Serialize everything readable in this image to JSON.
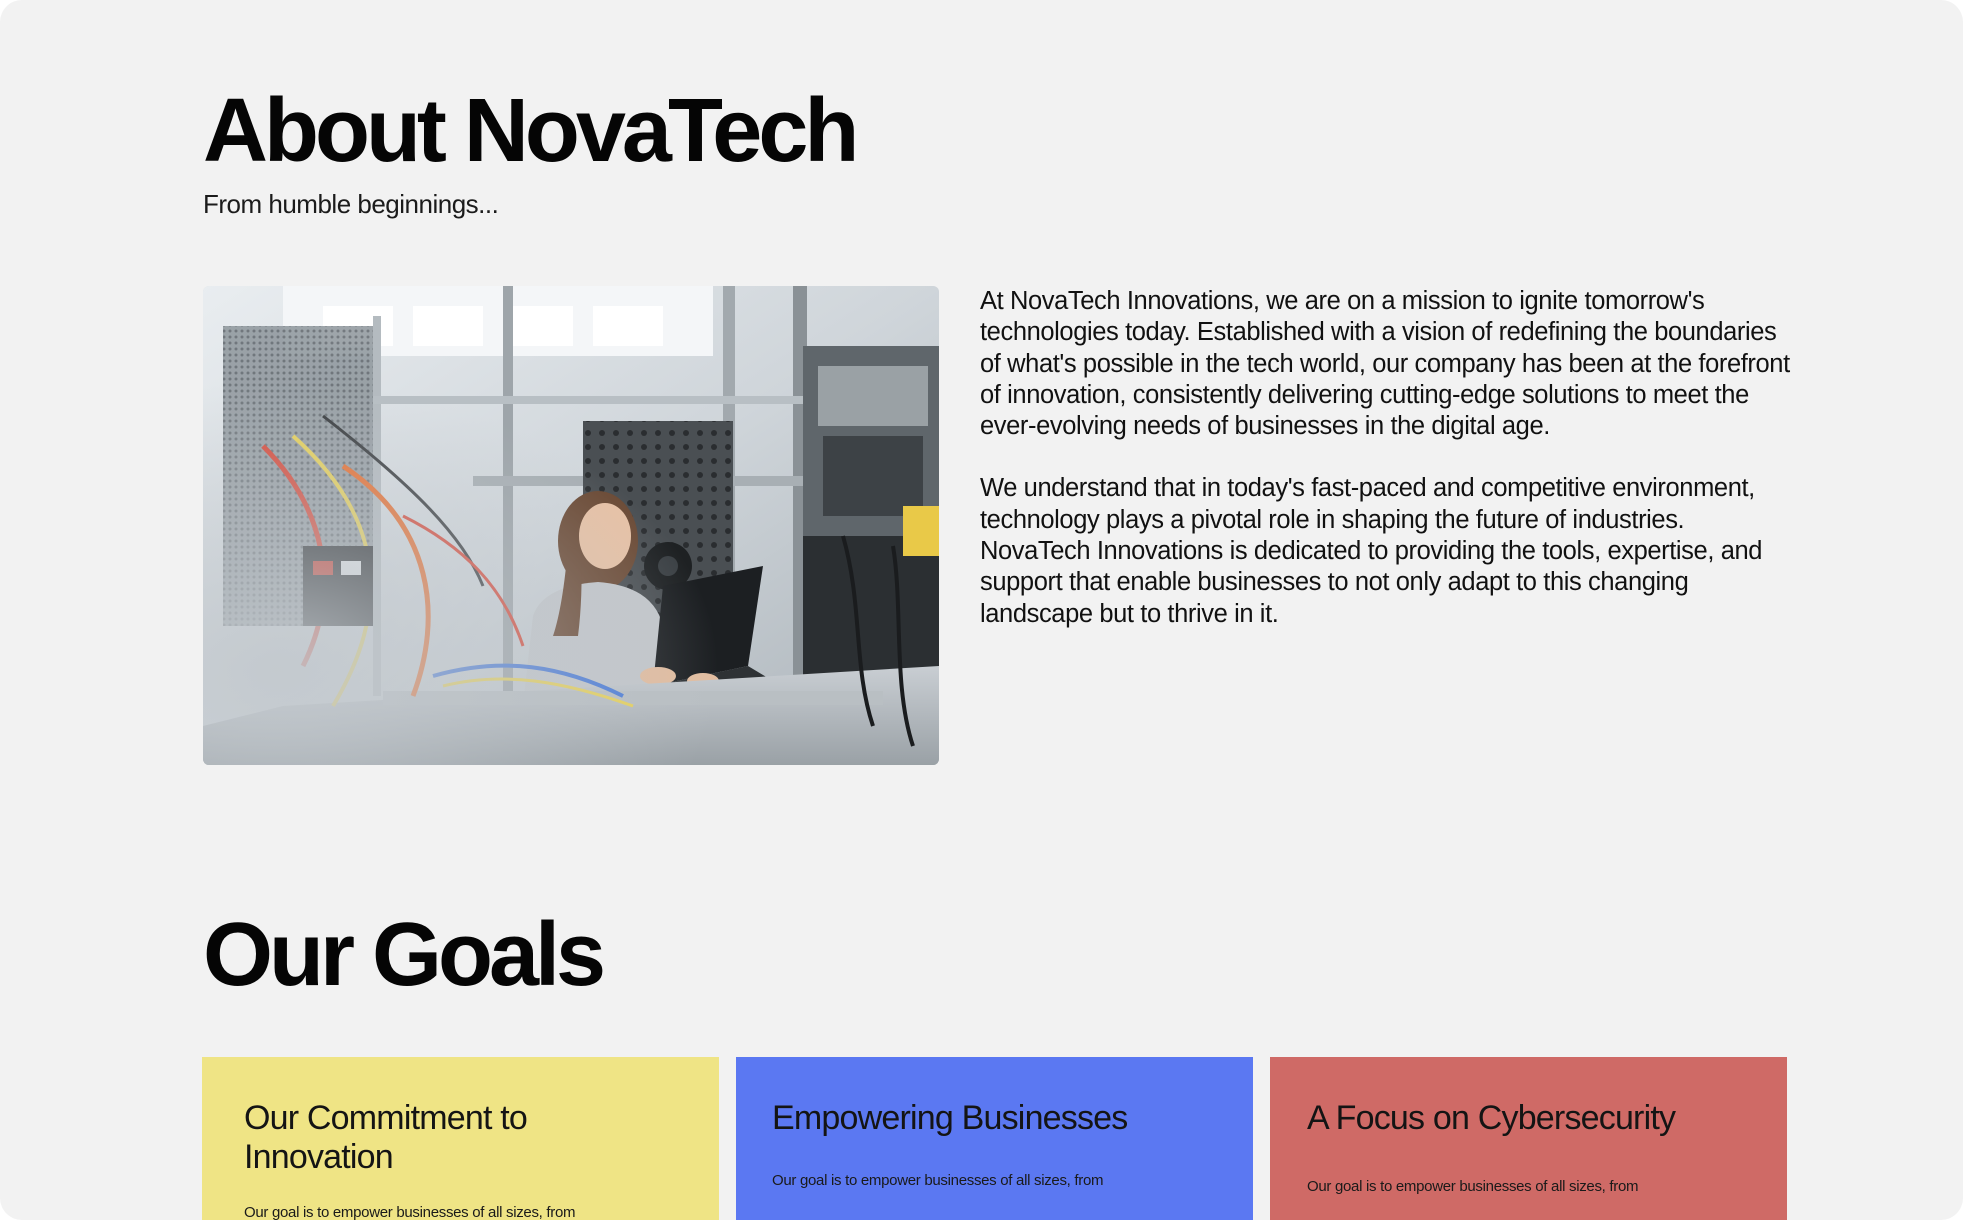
{
  "about": {
    "title": "About NovaTech",
    "subtitle": "From humble beginnings...",
    "photo_alt": "Engineer working on a laptop in an electronics lab",
    "paragraphs": [
      "At NovaTech Innovations, we are on a mission to ignite tomorrow's technologies today. Established with a vision of redefining the boundaries of what's possible in the tech world, our company has been at the forefront of innovation, consistently delivering cutting-edge solutions to meet the ever-evolving needs of businesses in the digital age.",
      "We understand that in today's fast-paced and competitive environment, technology plays a pivotal role in shaping the future of industries. NovaTech Innovations is dedicated to providing the tools, expertise, and support that enable businesses to not only adapt to this changing landscape but to thrive in it."
    ]
  },
  "goals": {
    "title": "Our Goals",
    "cards": [
      {
        "title": "Our Commitment to Innovation",
        "text": "Our goal is to empower businesses of all sizes, from",
        "color": "#efe485"
      },
      {
        "title": "Empowering Businesses",
        "text": "Our goal is to empower businesses of all sizes, from",
        "color": "#5b78f2"
      },
      {
        "title": "A Focus on Cybersecurity",
        "text": "Our goal is to empower businesses of all sizes, from",
        "color": "#cf6a66"
      }
    ]
  },
  "colors": {
    "page_background": "#f2f2f2",
    "heading_text": "#050505"
  }
}
